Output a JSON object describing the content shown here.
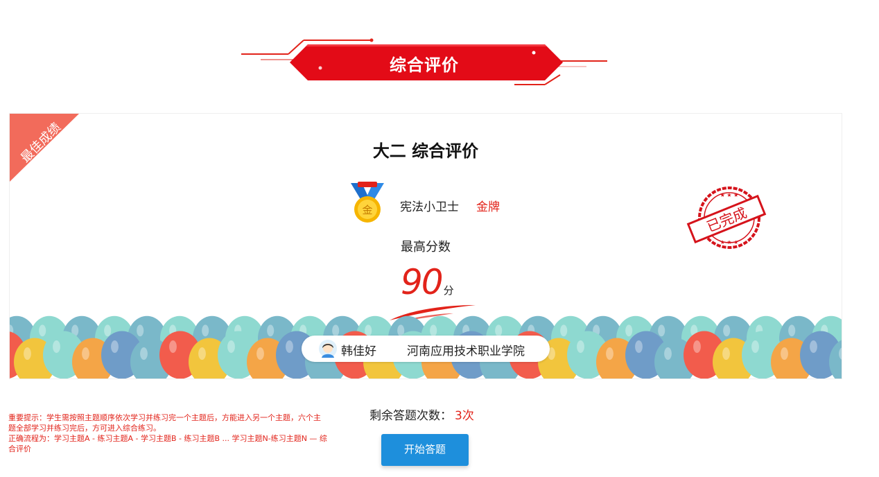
{
  "banner": {
    "title": "综合评价"
  },
  "card": {
    "ribbon_text": "最佳成绩",
    "title": "大二 综合评价",
    "medal": {
      "name": "宪法小卫士",
      "level": "金牌",
      "icon_text": "金"
    },
    "score_label": "最高分数",
    "score": "90",
    "score_unit": "分",
    "stamp_text": "已完成",
    "user": {
      "name": "韩佳好",
      "school": "河南应用技术职业学院"
    }
  },
  "notice": {
    "line1": "重要提示：学生需按照主题顺序依次学习并练习完一个主题后，方能进入另一个主题，六个主题全部学习并练习完后，方可进入综合练习。",
    "line2": "正确流程为：学习主题A - 练习主题A - 学习主题B - 练习主题B ... 学习主题N-练习主题N — 综合评价"
  },
  "remain": {
    "label": "剩余答题次数：",
    "value": "3次"
  },
  "start_button": "开始答题",
  "colors": {
    "accent_red": "#e2231a",
    "button_blue": "#1e8fdc",
    "ribbon": "#f26b5b"
  }
}
